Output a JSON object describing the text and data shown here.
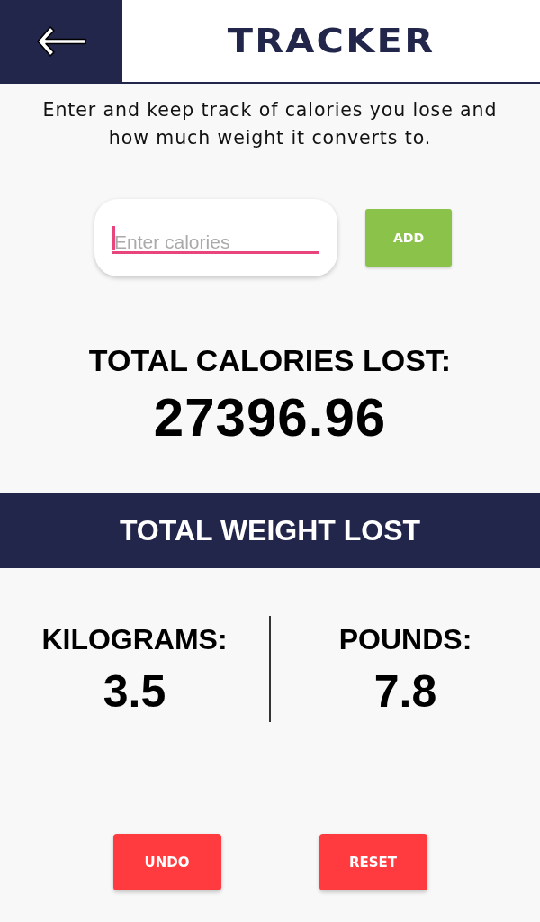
{
  "header": {
    "title": "TRACKER"
  },
  "description": "Enter and keep track of calories you lose and how much weight it converts to.",
  "calorie_input": {
    "placeholder": "Enter calories",
    "focused": true
  },
  "add_button": "ADD",
  "calories": {
    "label": "TOTAL CALORIES LOST:",
    "value": "27396.96"
  },
  "weight": {
    "title": "TOTAL WEIGHT LOST",
    "units": [
      {
        "label": "KILOGRAMS:",
        "value": "3.5"
      },
      {
        "label": "POUNDS:",
        "value": "7.8"
      }
    ]
  },
  "buttons": [
    "UNDO",
    "RESET"
  ]
}
